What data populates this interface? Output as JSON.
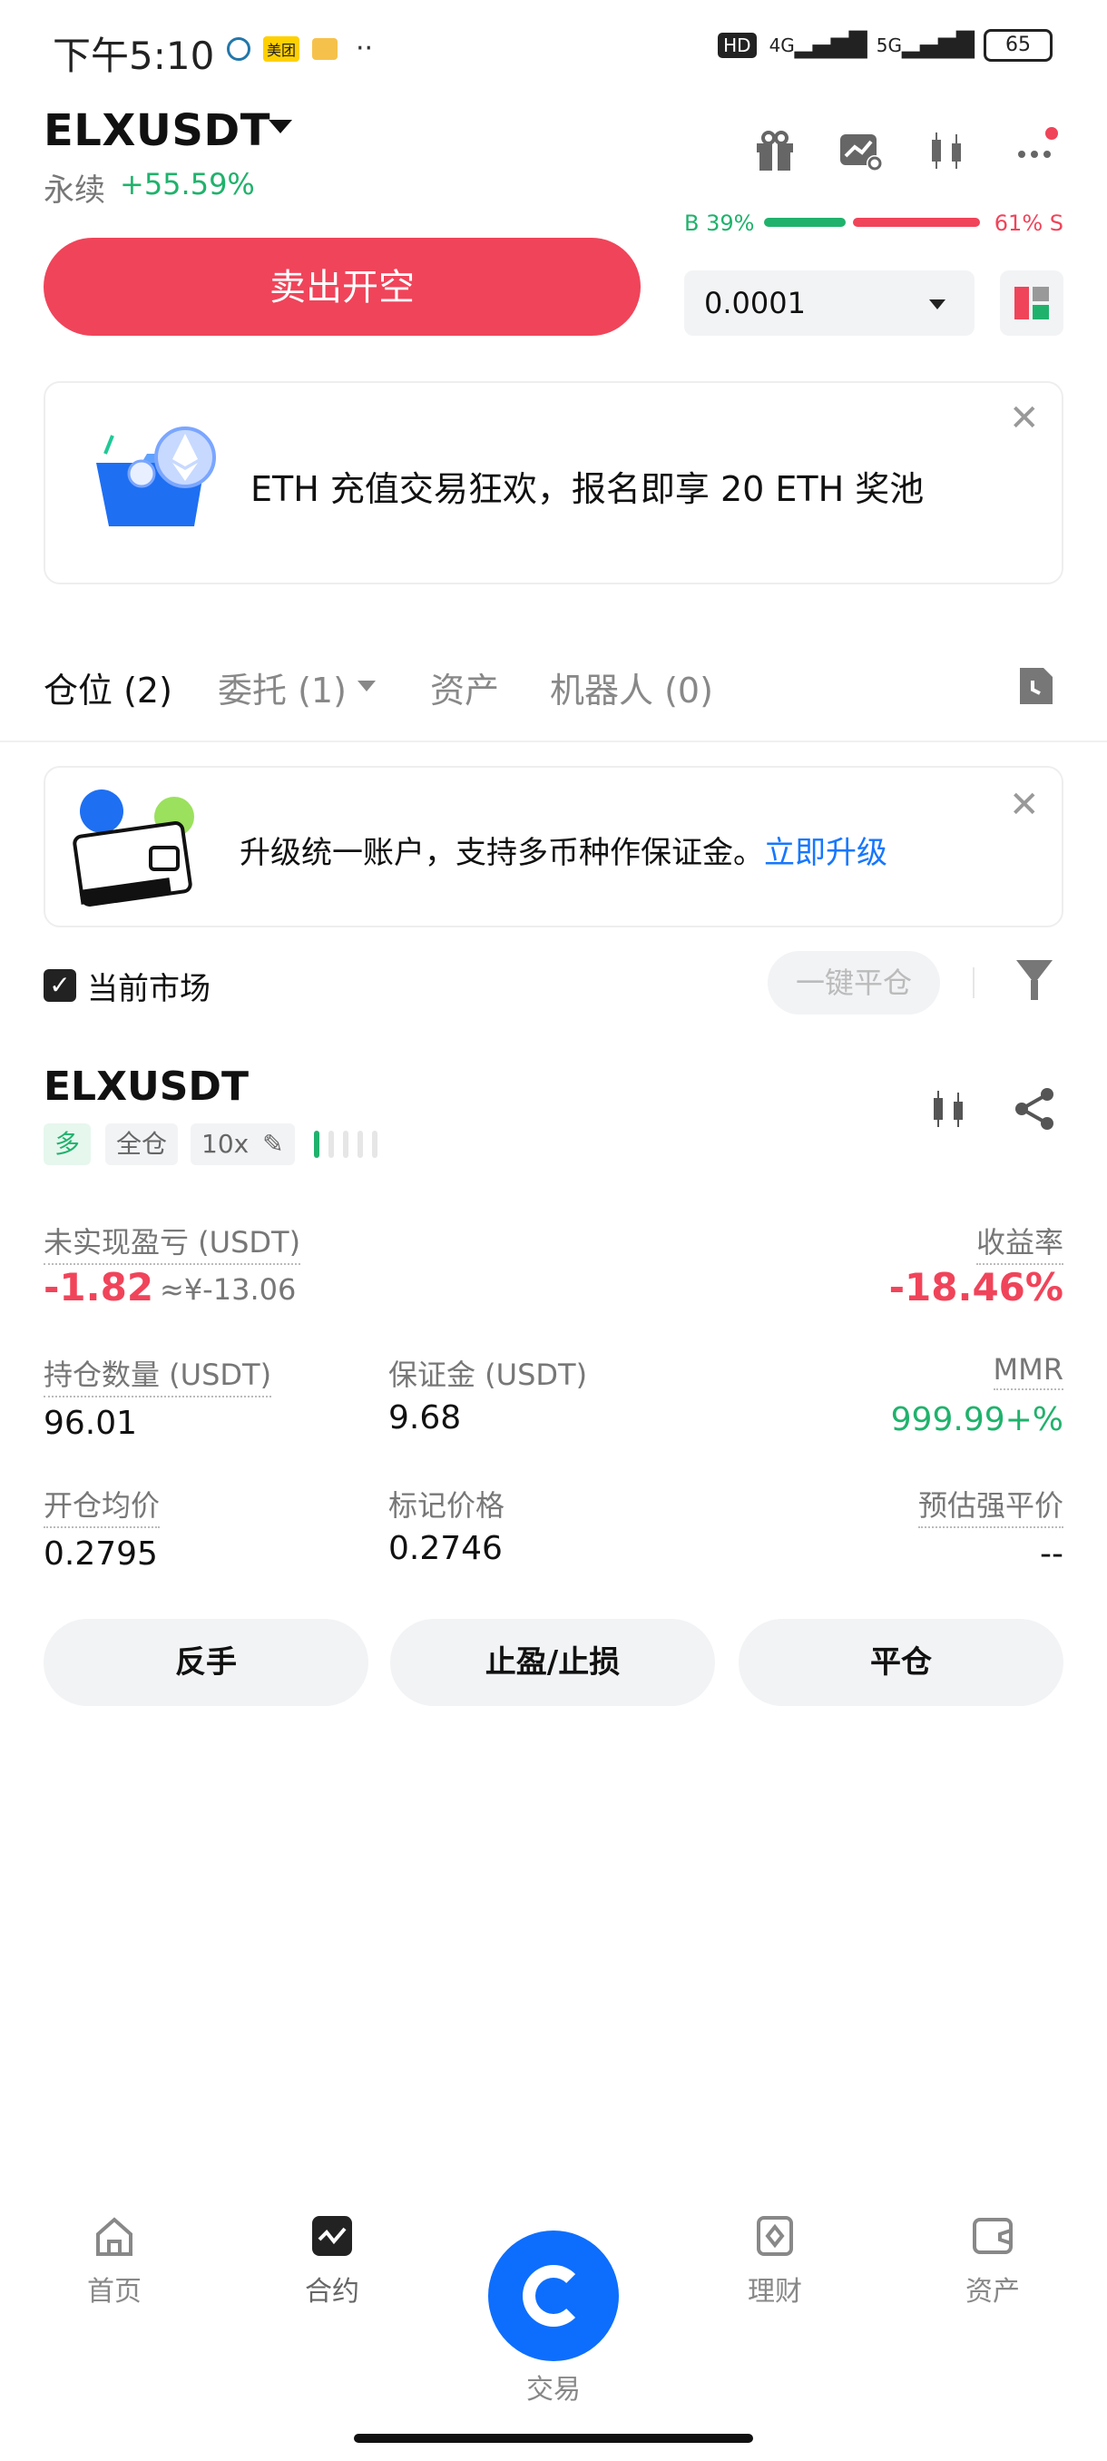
{
  "status_bar": {
    "time": "下午5:10",
    "hd": "HD",
    "net1": "4G",
    "net2": "5G",
    "battery": "65",
    "app_badge": "美团"
  },
  "header": {
    "symbol": "ELXUSDT",
    "market_type": "永续",
    "change": "+55.59%",
    "icons": [
      "gift-icon",
      "chart-alert-icon",
      "candlestick-icon",
      "more-icon"
    ]
  },
  "order": {
    "sell_label": "卖出开空",
    "buy_ratio": "B 39%",
    "sell_ratio": "61% S",
    "buy_ratio_fraction": 0.39,
    "amount": "0.0001"
  },
  "banner": {
    "text": "ETH 充值交易狂欢，报名即享 20 ETH 奖池"
  },
  "tabs": [
    {
      "label": "仓位 (2)"
    },
    {
      "label": "委托 (1)"
    },
    {
      "label": "资产"
    },
    {
      "label": "机器人 (0)"
    }
  ],
  "upgrade": {
    "text": "升级统一账户，支持多币种作保证金。",
    "link": "立即升级"
  },
  "filter": {
    "current_market": "当前市场",
    "close_all": "一键平仓",
    "checked": true
  },
  "position": {
    "symbol": "ELXUSDT",
    "tags": [
      "多",
      "全仓",
      "10x"
    ],
    "leverage_level": 1,
    "leverage_steps": 5,
    "unrealized_label": "未实现盈亏 (USDT)",
    "unrealized_value": "-1.82",
    "unrealized_fiat": "≈¥-13.06",
    "roe_label": "收益率",
    "roe_value": "-18.46%",
    "size_label": "持仓数量 (USDT)",
    "size_value": "96.01",
    "margin_label": "保证金 (USDT)",
    "margin_value": "9.68",
    "mmr_label": "MMR",
    "mmr_value": "999.99+%",
    "entry_label": "开仓均价",
    "entry_value": "0.2795",
    "mark_label": "标记价格",
    "mark_value": "0.2746",
    "liq_label": "预估强平价",
    "liq_value": "--",
    "buttons": [
      "反手",
      "止盈/止损",
      "平仓"
    ]
  },
  "nav": {
    "items": [
      "首页",
      "合约",
      "交易",
      "理财",
      "资产"
    ]
  },
  "colors": {
    "sell_red": "#f0445a",
    "buy_green": "#20b26c",
    "link_blue": "#1677ff",
    "fab_blue": "#0d6efd"
  }
}
